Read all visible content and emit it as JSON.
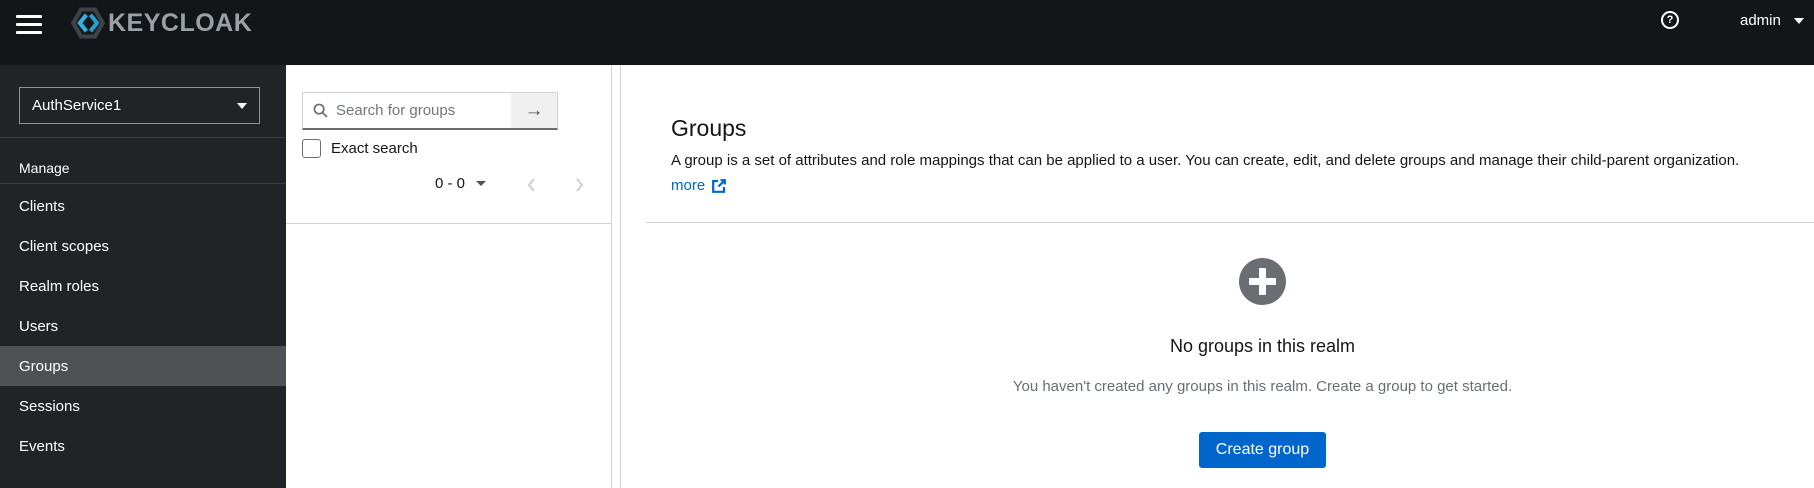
{
  "masthead": {
    "brand_text": "KEYCLOAK",
    "help_glyph": "?",
    "username": "admin"
  },
  "sidebar": {
    "realm": "AuthService1",
    "section_label": "Manage",
    "items": [
      {
        "label": "Clients"
      },
      {
        "label": "Client scopes"
      },
      {
        "label": "Realm roles"
      },
      {
        "label": "Users"
      },
      {
        "label": "Groups",
        "selected": true
      },
      {
        "label": "Sessions"
      },
      {
        "label": "Events"
      }
    ]
  },
  "tree_panel": {
    "search_placeholder": "Search for groups",
    "search_submit_glyph": "→",
    "exact_search_label": "Exact search",
    "pagination_range": "0 - 0"
  },
  "main": {
    "title": "Groups",
    "description": "A group is a set of attributes and role mappings that can be applied to a user. You can create, edit, and delete groups and manage their child-parent organization.",
    "more_label": "more",
    "empty": {
      "title": "No groups in this realm",
      "body": "You haven't created any groups in this realm. Create a group to get started.",
      "button_label": "Create group"
    }
  },
  "colors": {
    "accent": "#0066cc",
    "masthead_bg": "#131619",
    "sidebar_bg": "#212427",
    "selected_nav_bg": "#4f5255",
    "muted_text": "#6a6e73",
    "divider": "#d2d2d2",
    "empty_icon_bg": "#6a6e73"
  }
}
